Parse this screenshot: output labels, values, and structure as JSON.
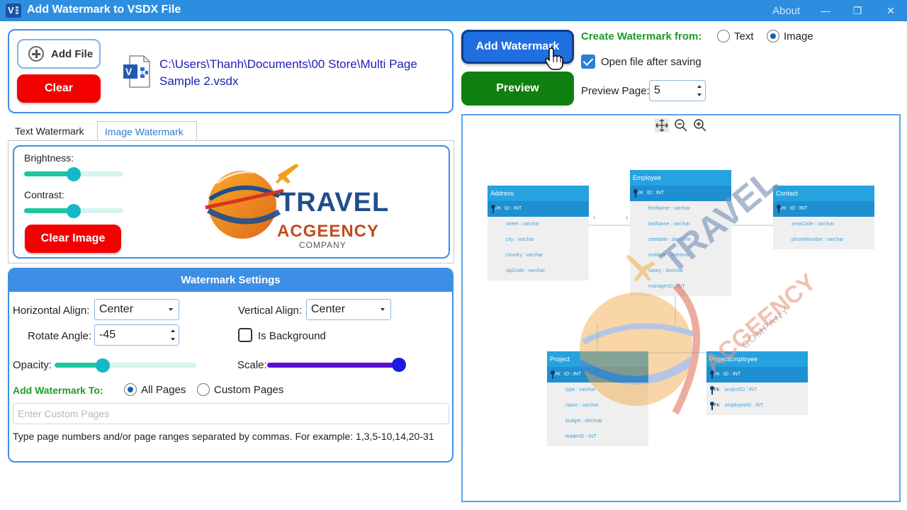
{
  "window": {
    "title": "Add Watermark to VSDX File",
    "about": "About",
    "minimize": "—",
    "restore": "❐",
    "close": "✕"
  },
  "file": {
    "add_label": "Add File",
    "clear_label": "Clear",
    "path": "C:\\Users\\Thanh\\Documents\\00 Store\\Multi Page Sample 2.vsdx"
  },
  "tabs": {
    "text": "Text Watermark",
    "image": "Image Watermark",
    "active": "image"
  },
  "image_tab": {
    "brightness_label": "Brightness:",
    "brightness_value": 0.5,
    "contrast_label": "Contrast:",
    "contrast_value": 0.5,
    "clear_image_label": "Clear Image",
    "logo": {
      "line1": "TRAVEL",
      "line2": "ACGEENCY",
      "line3": "COMPANY"
    }
  },
  "settings": {
    "header": "Watermark Settings",
    "h_align_label": "Horizontal Align:",
    "h_align_value": "Center",
    "v_align_label": "Vertical Align:",
    "v_align_value": "Center",
    "rotate_label": "Rotate Angle:",
    "rotate_value": "-45",
    "is_background_label": "Is Background",
    "is_background_checked": false,
    "opacity_label": "Opacity:",
    "opacity_value": 0.35,
    "scale_label": "Scale:",
    "scale_value": 1.0,
    "add_to_label": "Add Watermark To:",
    "all_pages_label": "All Pages",
    "custom_pages_label": "Custom Pages",
    "selected_scope": "all",
    "custom_pages_placeholder": "Enter Custom Pages",
    "hint": "Type page numbers and/or page ranges separated by commas. For example: 1,3,5-10,14,20-31"
  },
  "actions": {
    "add_watermark_label": "Add Watermark",
    "preview_label": "Preview"
  },
  "options": {
    "create_from_label": "Create Watermark from:",
    "text_option": "Text",
    "image_option": "Image",
    "selected_source": "image",
    "open_after_label": "Open file after saving",
    "open_after_checked": true,
    "preview_page_label": "Preview Page:",
    "preview_page_value": "5"
  },
  "preview": {
    "tables": [
      {
        "name": "Address",
        "pk": "ID : INT",
        "rows": [
          "street : varchar",
          "city : varchar",
          "country : varchar",
          "zipCode : varchar"
        ]
      },
      {
        "name": "Employee",
        "pk": "ID : INT",
        "rows": [
          "firstName : varchar",
          "lastName : varchar",
          "startdate : datetime",
          "enddate : datetime",
          "salary : decimal",
          "managerID : INT"
        ]
      },
      {
        "name": "Contact",
        "pk": "ID : INT",
        "rows": [
          "areaCode : varchar",
          "phoneNumber : varchar"
        ]
      },
      {
        "name": "Project",
        "pk": "ID : INT",
        "rows": [
          "type : varchar",
          "name : varchar",
          "budget : decimal",
          "leaderID : INT"
        ]
      },
      {
        "name": "ProjectEmployee",
        "pk": "ID : INT",
        "rows": [
          "projectID : INT",
          "employeeID : INT"
        ]
      }
    ],
    "pk_tag": "PK",
    "fk_tag": "FK",
    "watermark_text": [
      "TRAVEL",
      "ACGEENCY",
      "COMPANY"
    ],
    "rel_label": "1"
  },
  "colors": {
    "titlebar": "#2d8ee0",
    "accent_blue": "#3d8fe6",
    "clear_red": "#f40000",
    "preview_green": "#0f8010",
    "add_blue": "#1f6fe0",
    "slider_teal": "#1ec6a0",
    "thumb_teal": "#14b8c8",
    "scale_purple": "#5a0fd6",
    "scale_thumb": "#1a1ae0",
    "label_green": "#1e9a26",
    "er_header": "#26a2df"
  }
}
